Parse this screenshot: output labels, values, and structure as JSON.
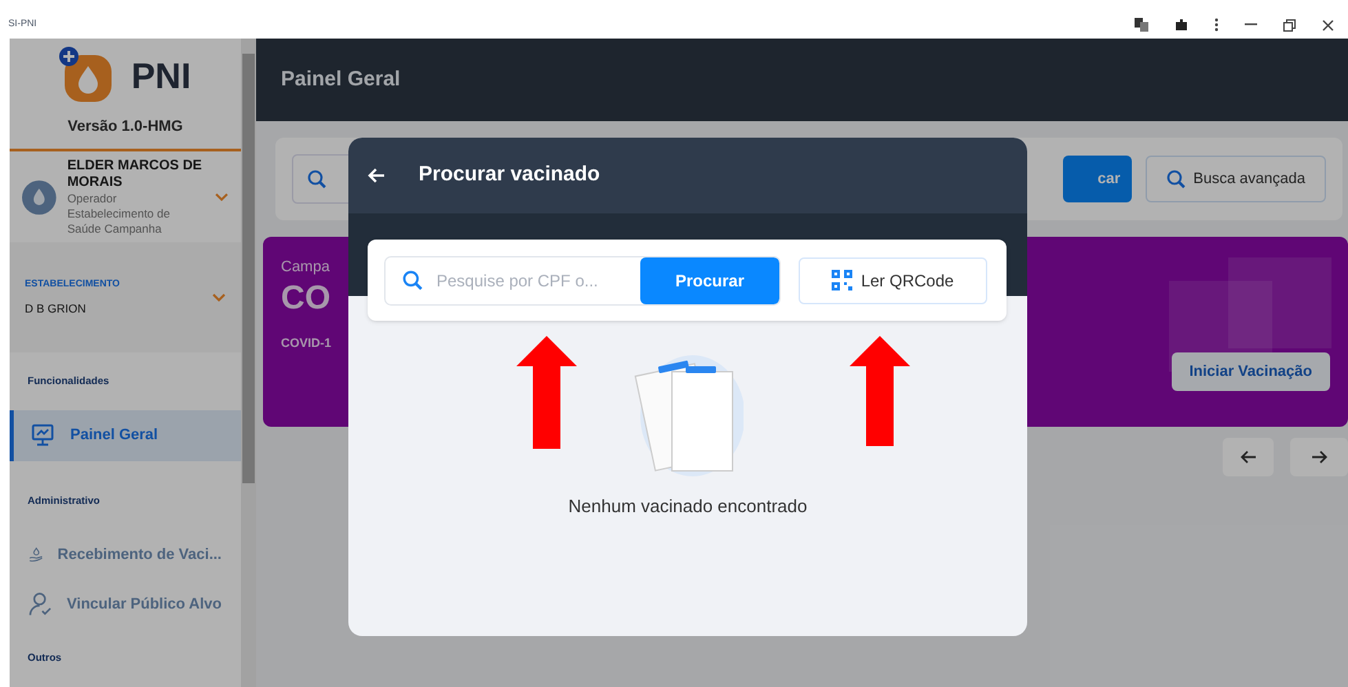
{
  "window": {
    "title": "SI-PNI"
  },
  "sidebar": {
    "logo_text": "PNI",
    "version": "Versão 1.0-HMG",
    "user": {
      "name": "ELDER MARCOS DE MORAIS",
      "role": "Operador",
      "unit": "Estabelecimento de Saúde Campanha"
    },
    "establishment": {
      "label": "ESTABELECIMENTO",
      "value": "D B GRION"
    },
    "sections": [
      {
        "title": "Funcionalidades",
        "items": [
          {
            "label": "Painel Geral",
            "kind": "monitor",
            "selected": true
          }
        ]
      },
      {
        "title": "Administrativo",
        "items": [
          {
            "label": "Recebimento de Vaci...",
            "kind": "hand",
            "selected": false
          },
          {
            "label": "Vincular Público Alvo",
            "kind": "user",
            "selected": false
          }
        ]
      },
      {
        "title": "Outros"
      }
    ]
  },
  "header": {
    "title": "Painel Geral"
  },
  "background": {
    "search_button": "car",
    "advanced_search_button": "Busca avançada",
    "campaign": {
      "label": "Campa",
      "title": "CO",
      "subtitle": "COVID-1",
      "button": "Iniciar Vacinação"
    }
  },
  "modal": {
    "title": "Procurar vacinado",
    "search": {
      "placeholder": "Pesquise por CPF o..."
    },
    "search_button": "Procurar",
    "qr_button": "Ler QRCode",
    "empty_message": "Nenhum vacinado encontrado"
  }
}
